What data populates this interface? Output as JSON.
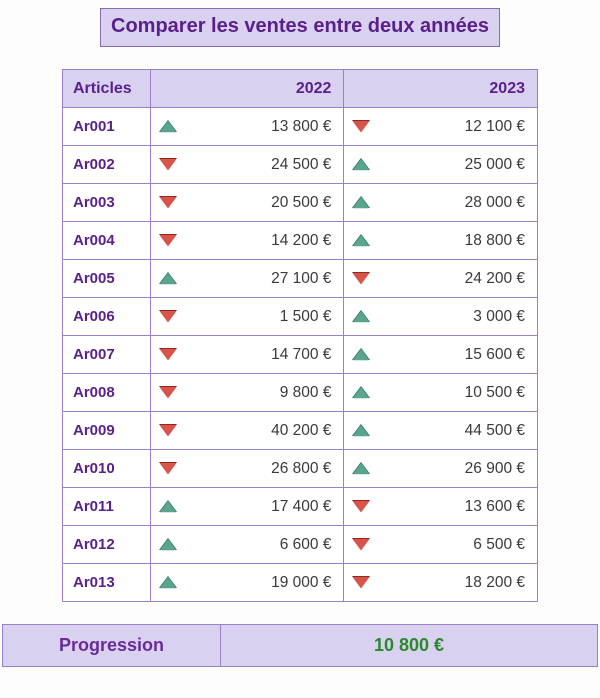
{
  "title": "Comparer les ventes entre deux années",
  "headers": {
    "article": "Articles",
    "y1": "2022",
    "y2": "2023"
  },
  "rows": [
    {
      "art": "Ar001",
      "d1": "up",
      "v1": "13 800 €",
      "d2": "down",
      "v2": "12 100 €"
    },
    {
      "art": "Ar002",
      "d1": "down",
      "v1": "24 500 €",
      "d2": "up",
      "v2": "25 000 €"
    },
    {
      "art": "Ar003",
      "d1": "down",
      "v1": "20 500 €",
      "d2": "up",
      "v2": "28 000 €"
    },
    {
      "art": "Ar004",
      "d1": "down",
      "v1": "14 200 €",
      "d2": "up",
      "v2": "18 800 €"
    },
    {
      "art": "Ar005",
      "d1": "up",
      "v1": "27 100 €",
      "d2": "down",
      "v2": "24 200 €"
    },
    {
      "art": "Ar006",
      "d1": "down",
      "v1": "1 500 €",
      "d2": "up",
      "v2": "3 000 €"
    },
    {
      "art": "Ar007",
      "d1": "down",
      "v1": "14 700 €",
      "d2": "up",
      "v2": "15 600 €"
    },
    {
      "art": "Ar008",
      "d1": "down",
      "v1": "9 800 €",
      "d2": "up",
      "v2": "10 500 €"
    },
    {
      "art": "Ar009",
      "d1": "down",
      "v1": "40 200 €",
      "d2": "up",
      "v2": "44 500 €"
    },
    {
      "art": "Ar010",
      "d1": "down",
      "v1": "26 800 €",
      "d2": "up",
      "v2": "26 900 €"
    },
    {
      "art": "Ar011",
      "d1": "up",
      "v1": "17 400 €",
      "d2": "down",
      "v2": "13 600 €"
    },
    {
      "art": "Ar012",
      "d1": "up",
      "v1": "6 600 €",
      "d2": "down",
      "v2": "6 500 €"
    },
    {
      "art": "Ar013",
      "d1": "up",
      "v1": "19 000 €",
      "d2": "down",
      "v2": "18 200 €"
    }
  ],
  "progression": {
    "label": "Progression",
    "value": "10 800 €"
  },
  "chart_data": {
    "type": "table",
    "title": "Comparer les ventes entre deux années",
    "columns": [
      "Articles",
      "2022",
      "2023"
    ],
    "series": [
      {
        "name": "2022",
        "values": [
          13800,
          24500,
          20500,
          14200,
          27100,
          1500,
          14700,
          9800,
          40200,
          26800,
          17400,
          6600,
          19000
        ]
      },
      {
        "name": "2023",
        "values": [
          12100,
          25000,
          28000,
          18800,
          24200,
          3000,
          15600,
          10500,
          44500,
          26900,
          13600,
          6500,
          18200
        ]
      }
    ],
    "categories": [
      "Ar001",
      "Ar002",
      "Ar003",
      "Ar004",
      "Ar005",
      "Ar006",
      "Ar007",
      "Ar008",
      "Ar009",
      "Ar010",
      "Ar011",
      "Ar012",
      "Ar013"
    ],
    "currency": "EUR",
    "progression_value": 10800
  }
}
